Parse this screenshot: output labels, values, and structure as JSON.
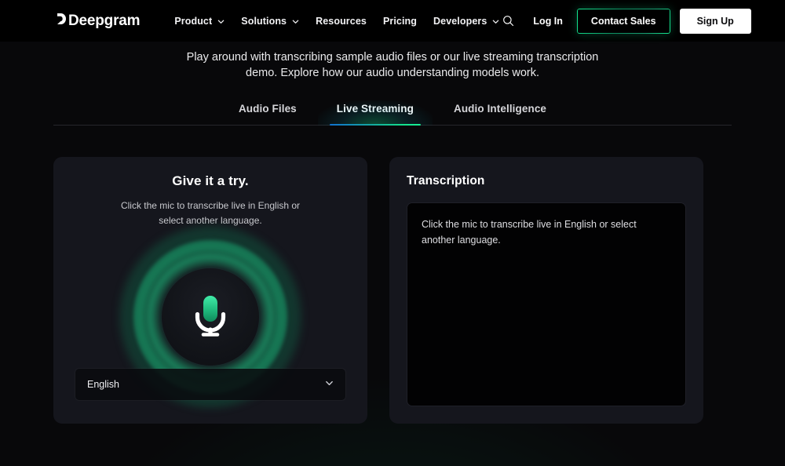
{
  "header": {
    "logo_text": "Deepgram",
    "nav": [
      {
        "label": "Product",
        "has_caret": true
      },
      {
        "label": "Solutions",
        "has_caret": true
      },
      {
        "label": "Resources",
        "has_caret": false
      },
      {
        "label": "Pricing",
        "has_caret": false
      },
      {
        "label": "Developers",
        "has_caret": true
      }
    ],
    "search_icon": "search-icon",
    "login_label": "Log In",
    "contact_label": "Contact Sales",
    "signup_label": "Sign Up"
  },
  "hero": {
    "subtitle": "Play around with transcribing sample audio files or our live streaming transcription demo. Explore how our audio understanding models work."
  },
  "tabs": [
    {
      "label": "Audio Files",
      "active": false
    },
    {
      "label": "Live Streaming",
      "active": true
    },
    {
      "label": "Audio Intelligence",
      "active": false
    }
  ],
  "try_card": {
    "title": "Give it a try.",
    "subtitle": "Click the mic to transcribe live in English or select another language.",
    "mic_icon": "microphone-icon",
    "language_value": "English",
    "language_caret_icon": "chevron-down-icon"
  },
  "transcription_card": {
    "title": "Transcription",
    "body_text": "Click the mic to transcribe live in English or select another language."
  },
  "colors": {
    "background": "#08080a",
    "card": "#15161d",
    "accent_green": "#13ef93",
    "accent_blue": "#1170cf",
    "signup_bg": "#ffffff",
    "transcript_bg": "#020203"
  }
}
